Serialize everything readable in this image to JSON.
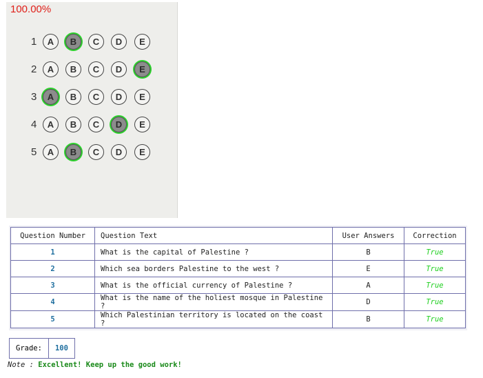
{
  "sheet": {
    "score": "100.00%",
    "letters": [
      "A",
      "B",
      "C",
      "D",
      "E"
    ],
    "rows": [
      {
        "number": "1",
        "marked": "B"
      },
      {
        "number": "2",
        "marked": "E"
      },
      {
        "number": "3",
        "marked": "A"
      },
      {
        "number": "4",
        "marked": "D"
      },
      {
        "number": "5",
        "marked": "B"
      }
    ]
  },
  "table": {
    "headers": [
      "Question Number",
      "Question Text",
      "User Answers",
      "Correction"
    ],
    "rows": [
      {
        "number": "1",
        "text": "What is the capital of Palestine ?",
        "answer": "B",
        "correction": "True"
      },
      {
        "number": "2",
        "text": "Which sea borders Palestine to the west ?",
        "answer": "E",
        "correction": "True"
      },
      {
        "number": "3",
        "text": "What is the official currency of Palestine ?",
        "answer": "A",
        "correction": "True"
      },
      {
        "number": "4",
        "text": "What is the name of the holiest mosque in Palestine ?",
        "answer": "D",
        "correction": "True"
      },
      {
        "number": "5",
        "text": "Which Palestinian territory is located on the coast ?",
        "answer": "B",
        "correction": "True"
      }
    ]
  },
  "grade": {
    "label": "Grade:",
    "value": "100"
  },
  "note": {
    "label": "Note : ",
    "message": "Excellent! Keep up the good work!"
  },
  "colors": {
    "marked_ring": "#2ed12e",
    "score": "#e0201a",
    "correction": "#1fcf1f",
    "table_border": "#6e6eaa"
  }
}
